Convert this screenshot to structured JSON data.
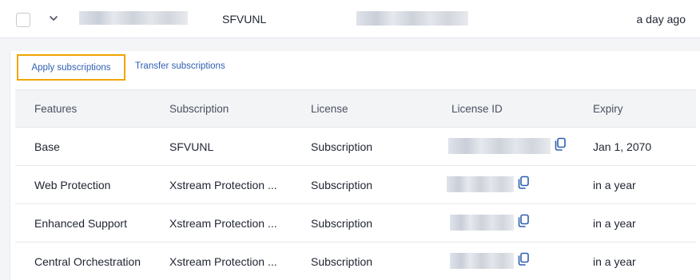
{
  "device": {
    "model": "SFVUNL",
    "last_seen": "a day ago"
  },
  "tabs": {
    "apply": "Apply subscriptions",
    "transfer": "Transfer subscriptions"
  },
  "table": {
    "headers": [
      "Features",
      "Subscription",
      "License",
      "License ID",
      "Expiry"
    ],
    "rows": [
      {
        "feature": "Base",
        "subscription": "SFVUNL",
        "license": "Subscription",
        "expiry": "Jan 1, 2070"
      },
      {
        "feature": "Web Protection",
        "subscription": "Xstream Protection ...",
        "license": "Subscription",
        "expiry": "in a year"
      },
      {
        "feature": "Enhanced Support",
        "subscription": "Xstream Protection ...",
        "license": "Subscription",
        "expiry": "in a year"
      },
      {
        "feature": "Central Orchestration",
        "subscription": "Xstream Protection ...",
        "license": "Subscription",
        "expiry": "in a year"
      }
    ]
  },
  "icons": {
    "checkbox": "checkbox-icon",
    "expand": "chevron-down-icon",
    "copy": "copy-icon"
  },
  "colors": {
    "link": "#2f5fb3",
    "highlight": "#f0a500"
  }
}
